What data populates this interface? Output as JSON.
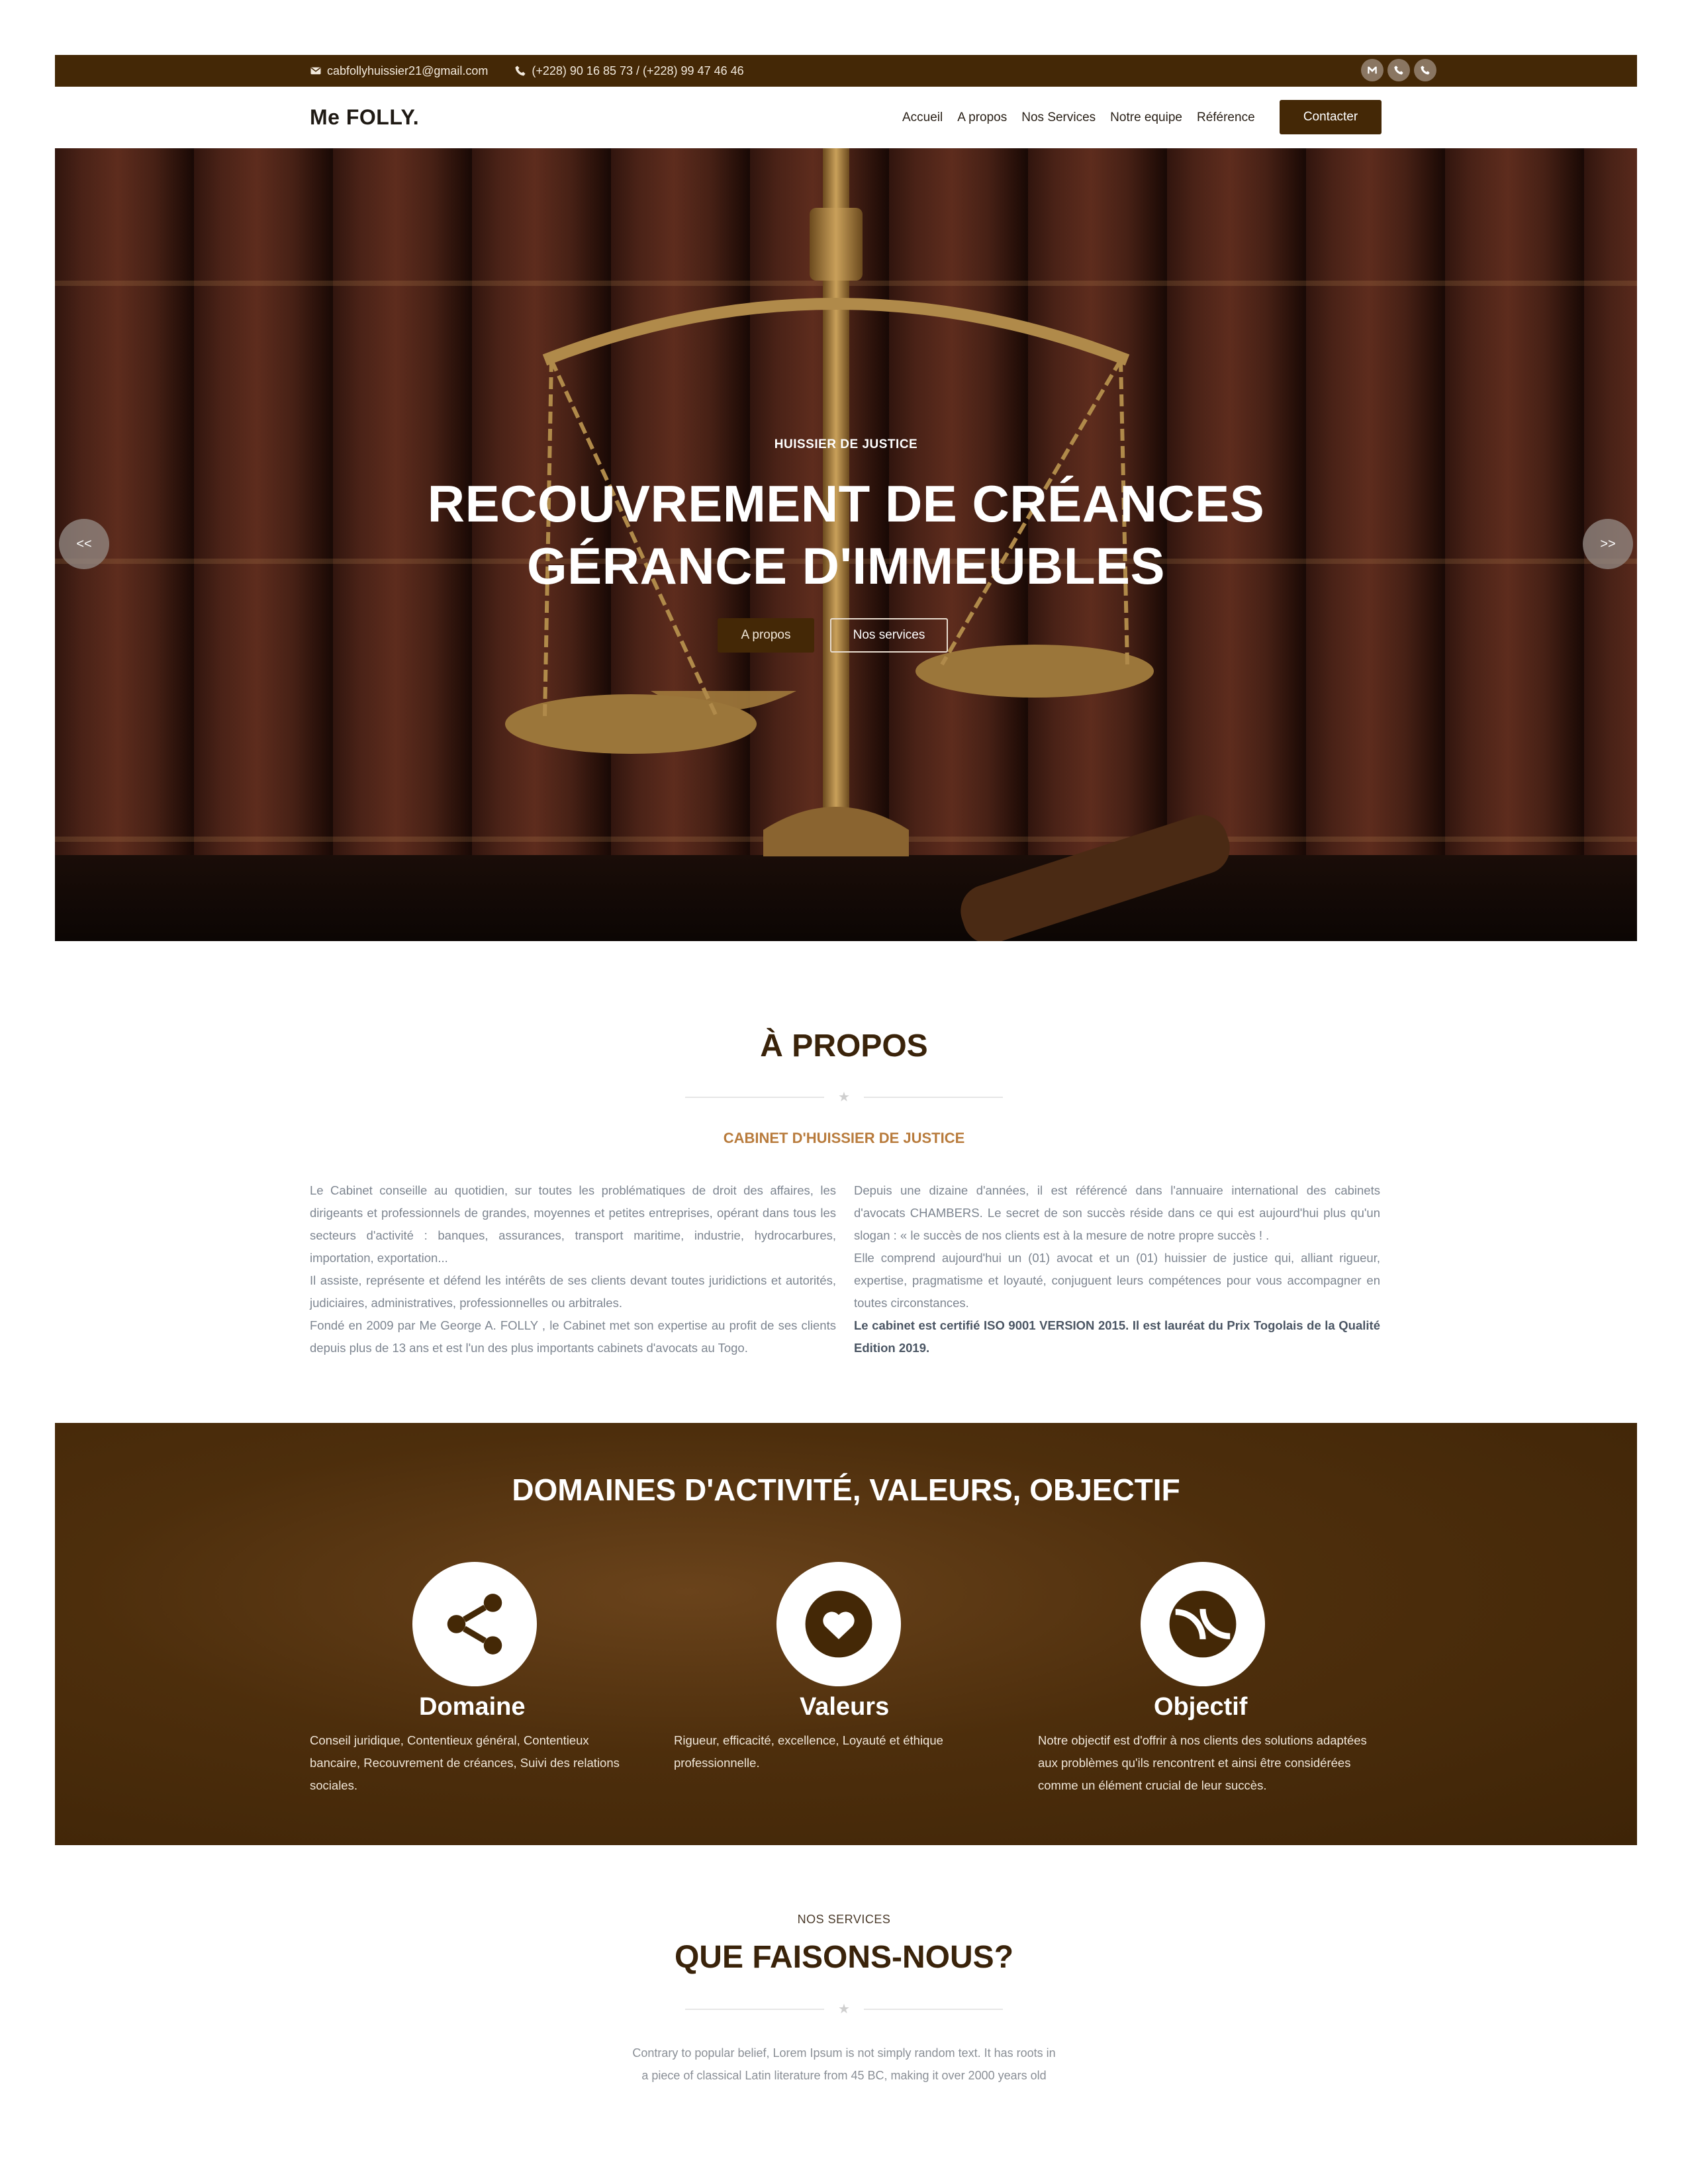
{
  "topbar": {
    "email": "cabfollyhuissier21@gmail.com",
    "phones": "(+228) 90 16 85 73 / (+228) 99 47 46 46",
    "icons": [
      "mail-icon",
      "phone-icon",
      "phone-icon"
    ]
  },
  "navbar": {
    "brand": "Me FOLLY.",
    "links": [
      "Accueil",
      "A propos",
      "Nos Services",
      "Notre equipe",
      "Référence"
    ],
    "contact_button": "Contacter"
  },
  "hero": {
    "subtitle": "HUISSIER DE JUSTICE",
    "title_line1": "RECOUVREMENT DE CRÉANCES",
    "title_line2": "GÉRANCE D'IMMEUBLES",
    "btn_primary": "A propos",
    "btn_secondary": "Nos services",
    "prev_arrow": "<<",
    "next_arrow": ">>"
  },
  "about": {
    "title": "À PROPOS",
    "subtitle": "CABINET D'HUISSIER DE JUSTICE",
    "left_p1": "Le Cabinet conseille au quotidien, sur toutes les problématiques de droit des affaires, les dirigeants et professionnels de grandes, moyennes et petites entreprises, opérant dans tous les secteurs d'activité : banques, assurances, transport maritime, industrie, hydrocarbures, importation, exportation...",
    "left_p2": "Il assiste, représente et défend les intérêts de ses clients devant toutes juridictions et autorités, judiciaires, administratives, professionnelles ou arbitrales.",
    "left_p3": "Fondé en 2009 par Me George A. FOLLY , le Cabinet met son expertise au profit de ses clients depuis plus de 13 ans et est l'un des plus importants cabinets d'avocats au Togo.",
    "right_p1": "Depuis une dizaine d'années, il est référencé dans l'annuaire international des cabinets d'avocats CHAMBERS. Le secret de son succès réside dans ce qui est aujourd'hui plus qu'un slogan : « le succès de nos clients est à la mesure de notre propre succès ! .",
    "right_p2": "Elle comprend aujourd'hui un (01) avocat et un (01) huissier de justice qui, alliant rigueur, expertise, pragmatisme et loyauté, conjuguent leurs compétences pour vous accompagner en toutes circonstances.",
    "right_p3": "Le cabinet est certifié ISO 9001 VERSION 2015. Il est lauréat du Prix Togolais de la Qualité Edition 2019."
  },
  "domains": {
    "title": "DOMAINES D'ACTIVITÉ, VALEURS, OBJECTIF",
    "items": [
      {
        "name": "Domaine",
        "icon": "share-icon",
        "desc": "Conseil juridique, Contentieux général, Contentieux bancaire, Recouvrement de créances, Suivi des relations sociales."
      },
      {
        "name": "Valeurs",
        "icon": "heart-icon",
        "desc": "Rigueur, efficacité, excellence, Loyauté et éthique professionnelle."
      },
      {
        "name": "Objectif",
        "icon": "tennis-ball-icon",
        "desc": "Notre objectif est d'offrir à nos clients des solutions adaptées aux problèmes qu'ils rencontrent et ainsi être considérées comme un élément crucial de leur succès."
      }
    ]
  },
  "services": {
    "label": "NOS SERVICES",
    "title": "QUE FAISONS-NOUS?",
    "text": "Contrary to popular belief, Lorem Ipsum is not simply random text. It has roots in a piece of classical Latin literature from 45 BC, making it over 2000 years old"
  },
  "colors": {
    "brand_brown": "#442806",
    "accent_gold": "#b87b3c",
    "title_brown": "#3a230a"
  }
}
